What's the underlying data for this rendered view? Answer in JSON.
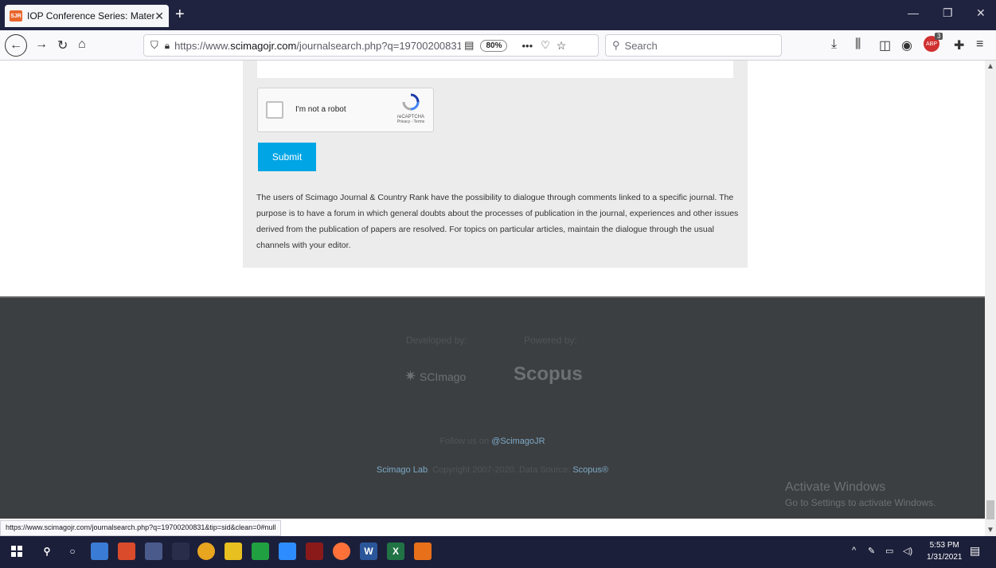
{
  "browser": {
    "tab_favicon": "SJR",
    "tab_title": "IOP Conference Series: Materials",
    "tab_close": "✕",
    "new_tab": "+",
    "url_prefix": "https://www.",
    "url_domain": "scimagojr.com",
    "url_path": "/journalsearch.php?q=19700200831",
    "zoom": "80%",
    "search_placeholder": "Search"
  },
  "form": {
    "captcha_label": "I'm not a robot",
    "captcha_brand": "reCAPTCHA",
    "captcha_terms": "Privacy - Terms",
    "submit_label": "Submit",
    "description": "The users of Scimago Journal & Country Rank have the possibility to dialogue through comments linked to a specific journal. The purpose is to have a forum in which general doubts about the processes of publication in the journal, experiences and other issues derived from the publication of papers are resolved. For topics on particular articles, maintain the dialogue through the usual channels with your editor."
  },
  "footer": {
    "developed_by": "Developed by:",
    "powered_by": "Powered by:",
    "scimago_logo": "SCImago",
    "scopus_logo": "Scopus",
    "follow_prefix": "Follow us on ",
    "follow_handle": "@ScimagoJR",
    "lab_link": "Scimago Lab",
    "copyright": ", Copyright 2007-2020. Data Source: ",
    "source_link": "Scopus®"
  },
  "watermark": {
    "title": "Activate Windows",
    "subtitle": "Go to Settings to activate Windows."
  },
  "status_url": "https://www.scimagojr.com/journalsearch.php?q=19700200831&tip=sid&clean=0#null",
  "system": {
    "time": "5:53 PM",
    "date": "1/31/2021",
    "abp_badge": "3"
  },
  "colors": {
    "accent": "#00a5e5",
    "footer_bg": "#3c3f41",
    "taskbar_bg": "#1c1f3a"
  }
}
